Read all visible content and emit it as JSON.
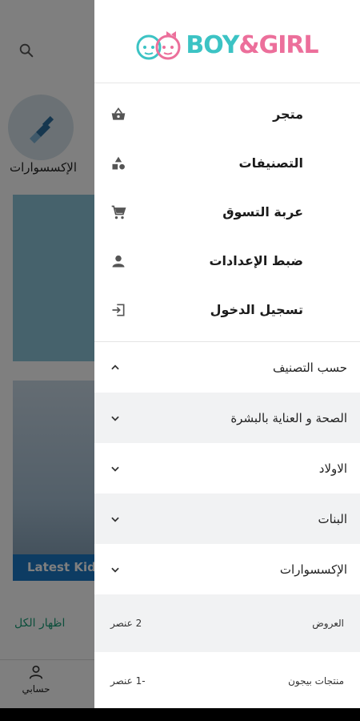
{
  "background": {
    "category_label": "الإكسسوارات",
    "banner_caption": "Latest Kid",
    "show_all": "اظهار الكل",
    "bottom_nav_account": "حسابي"
  },
  "drawer": {
    "logo": {
      "boy": "BOY",
      "amp": "&",
      "girl": "GIRL"
    },
    "menu": [
      {
        "label": "متجر",
        "icon": "shopping-basket-icon"
      },
      {
        "label": "التصنيفات",
        "icon": "categories-shapes-icon"
      },
      {
        "label": "عربة التسوق",
        "icon": "shopping-cart-icon"
      },
      {
        "label": "ضبط الإعدادات",
        "icon": "person-icon"
      },
      {
        "label": "تسجيل الدخول",
        "icon": "login-icon"
      }
    ],
    "sections": [
      {
        "label": "حسب التصنيف",
        "expanded": true
      },
      {
        "label": "الصحة و العناية بالبشرة",
        "expanded": false
      },
      {
        "label": "الاولاد",
        "expanded": false
      },
      {
        "label": "البنات",
        "expanded": false
      },
      {
        "label": "الإكسسوارات",
        "expanded": false
      }
    ],
    "offers": [
      {
        "label": "العروض",
        "count": "2 عنصر"
      },
      {
        "label": "منتجات بيجون",
        "count": "-1 عنصر"
      }
    ]
  },
  "colors": {
    "brand_teal": "#3cc3c4",
    "brand_pink": "#ec6f9b",
    "accent_green": "#1a9e78"
  }
}
